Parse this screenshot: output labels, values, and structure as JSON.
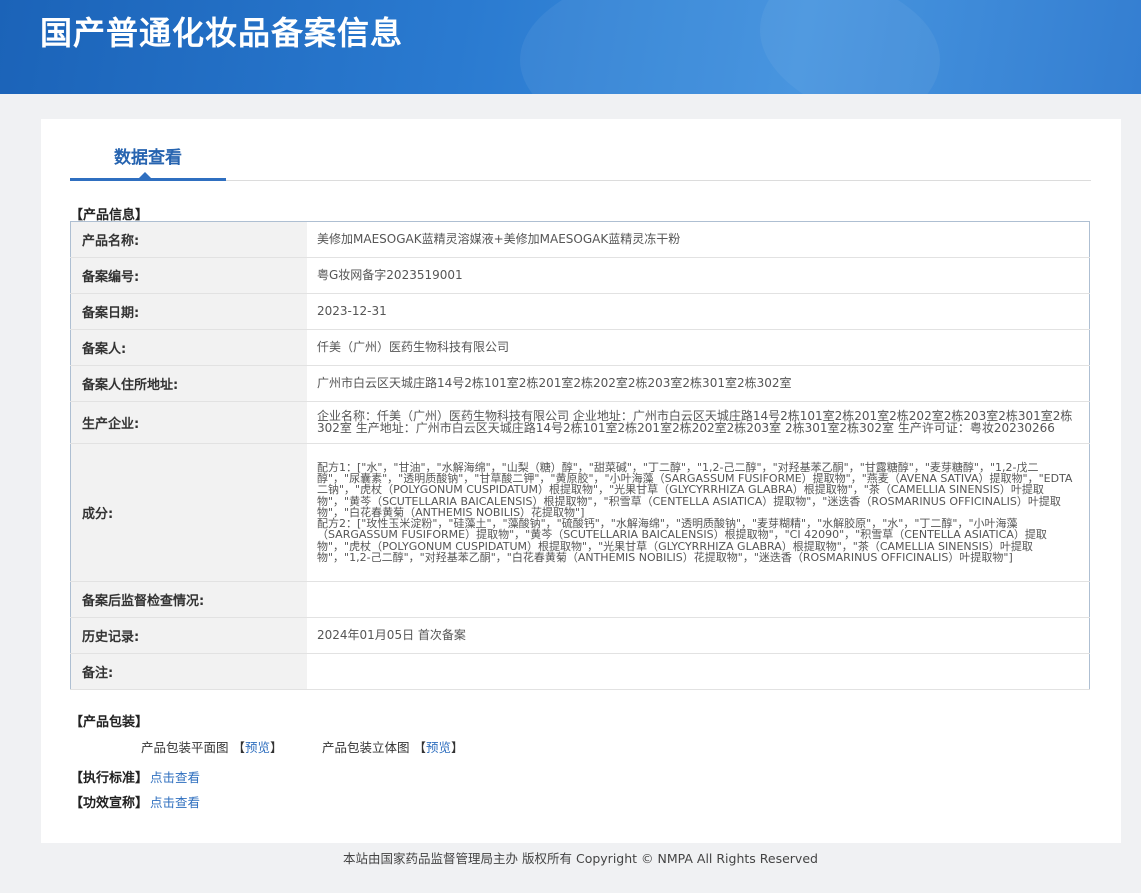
{
  "header": {
    "title": "国产普通化妆品备案信息"
  },
  "tabs": [
    {
      "label": "数据查看"
    }
  ],
  "product_info": {
    "section_label": "【产品信息】",
    "rows": [
      {
        "key": "产品名称:",
        "value": "美修加MAESOGAK蓝精灵溶媒液+美修加MAESOGAK蓝精灵冻干粉"
      },
      {
        "key": "备案编号:",
        "value": "粤G妆网备字2023519001"
      },
      {
        "key": "备案日期:",
        "value": "2023-12-31"
      },
      {
        "key": "备案人:",
        "value": "仟美（广州）医药生物科技有限公司"
      },
      {
        "key": "备案人住所地址:",
        "value": "广州市白云区天城庄路14号2栋101室2栋201室2栋202室2栋203室2栋301室2栋302室"
      },
      {
        "key": "生产企业:",
        "value": "企业名称：仟美（广州）医药生物科技有限公司 企业地址：广州市白云区天城庄路14号2栋101室2栋201室2栋202室2栋203室2栋301室2栋302室 生产地址：广州市白云区天城庄路14号2栋101室2栋201室2栋202室2栋203室 2栋301室2栋302室 生产许可证：粤妆20230266"
      },
      {
        "key": "成分:",
        "value": "配方1：[\"水\"，\"甘油\"，\"水解海绵\"，\"山梨（糖）醇\"，\"甜菜碱\"，\"丁二醇\"，\"1,2-己二醇\"，\"对羟基苯乙酮\"，\"甘露糖醇\"，\"麦芽糖醇\"，\"1,2-戊二醇\"，\"尿囊素\"，\"透明质酸钠\"，\"甘草酸二钾\"，\"黄原胶\"，\"小叶海藻（SARGASSUM FUSIFORME）提取物\"，\"燕麦（AVENA SATIVA）提取物\"，\"EDTA 二钠\"，\"虎杖（POLYGONUM CUSPIDATUM）根提取物\"，\"光果甘草（GLYCYRRHIZA GLABRA）根提取物\"，\"茶（CAMELLIA SINENSIS）叶提取物\"，\"黄芩（SCUTELLARIA BAICALENSIS）根提取物\"，\"积雪草（CENTELLA ASIATICA）提取物\"，\"迷迭香（ROSMARINUS OFFICINALIS）叶提取物\"，\"白花春黄菊（ANTHEMIS NOBILIS）花提取物\"]\n配方2：[\"玫性玉米淀粉\"，\"硅藻土\"，\"藻酸钠\"，\"硫酸钙\"，\"水解海绵\"，\"透明质酸钠\"，\"麦芽糊精\"，\"水解胶原\"，\"水\"，\"丁二醇\"，\"小叶海藻（SARGASSUM FUSIFORME）提取物\"，\"黄芩（SCUTELLARIA BAICALENSIS）根提取物\"，\"CI 42090\"，\"积雪草（CENTELLA ASIATICA）提取物\"，\"虎杖（POLYGONUM CUSPIDATUM）根提取物\"，\"光果甘草（GLYCYRRHIZA GLABRA）根提取物\"，\"茶（CAMELLIA SINENSIS）叶提取物\"，\"1,2-己二醇\"，\"对羟基苯乙酮\"，\"白花春黄菊（ANTHEMIS NOBILIS）花提取物\"，\"迷迭香（ROSMARINUS OFFICINALIS）叶提取物\"]"
      },
      {
        "key": "备案后监督检查情况:",
        "value": ""
      },
      {
        "key": "历史记录:",
        "value": "2024年01月05日 首次备案"
      },
      {
        "key": "备注:",
        "value": ""
      }
    ]
  },
  "packaging": {
    "section_label": "【产品包装】",
    "flat_label": "产品包装平面图",
    "solid_label": "产品包装立体图",
    "bracket_open": "【",
    "bracket_close": "】",
    "preview_link": "预览"
  },
  "standard": {
    "label": "【执行标准】",
    "link": "点击查看"
  },
  "efficacy": {
    "label": "【功效宣称】",
    "link": "点击查看"
  },
  "footer": {
    "text": "本站由国家药品监督管理局主办 版权所有 Copyright © NMPA All Rights Reserved"
  }
}
